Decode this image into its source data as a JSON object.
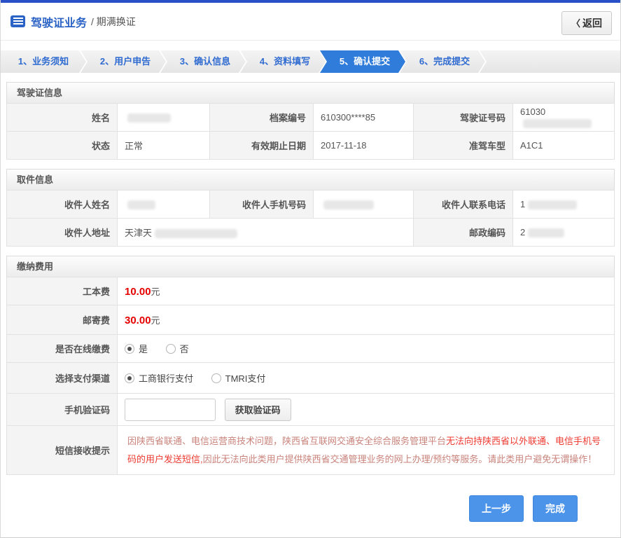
{
  "header": {
    "title": "驾驶证业务",
    "subtitle": "/ 期满换证",
    "back_icon": "〈",
    "back_label": "返回"
  },
  "steps": [
    {
      "label": "1、业务须知",
      "active": false
    },
    {
      "label": "2、用户申告",
      "active": false
    },
    {
      "label": "3、确认信息",
      "active": false
    },
    {
      "label": "4、资料填写",
      "active": false
    },
    {
      "label": "5、确认提交",
      "active": true
    },
    {
      "label": "6、完成提交",
      "active": false
    }
  ],
  "license": {
    "title": "驾驶证信息",
    "name_label": "姓名",
    "name_value": "",
    "file_no_label": "档案编号",
    "file_no_value": "610300****85",
    "license_no_label": "驾驶证号码",
    "license_no_value": "61030",
    "status_label": "状态",
    "status_value": "正常",
    "expiry_label": "有效期止日期",
    "expiry_value": "2017-11-18",
    "vehicle_class_label": "准驾车型",
    "vehicle_class_value": "A1C1"
  },
  "pickup": {
    "title": "取件信息",
    "recipient_name_label": "收件人姓名",
    "recipient_name_value": "",
    "recipient_mobile_label": "收件人手机号码",
    "recipient_mobile_value": "",
    "recipient_phone_label": "收件人联系电话",
    "recipient_phone_value": "1",
    "recipient_address_label": "收件人地址",
    "recipient_address_value": "天津天",
    "postal_code_label": "邮政编码",
    "postal_code_value": "2"
  },
  "fees": {
    "title": "缴纳费用",
    "cost_label": "工本费",
    "cost_value": "10.00",
    "cost_unit": "元",
    "postage_label": "邮寄费",
    "postage_value": "30.00",
    "postage_unit": "元",
    "online_pay_label": "是否在线缴费",
    "online_yes": "是",
    "online_no": "否",
    "online_selected": "是",
    "channel_label": "选择支付渠道",
    "channel_icbc": "工商银行支付",
    "channel_tmri": "TMRI支付",
    "channel_selected": "工商银行支付",
    "sms_code_label": "手机验证码",
    "sms_code_value": "",
    "get_code_button": "获取验证码",
    "notice_label": "短信接收提示",
    "notice_part1": "因陕西省联通、电信运营商技术问题，陕西省互联网交通安全综合服务管理平台",
    "notice_part2": "无法向持陕西省以外联通、电信手机号码的用户发送短信,",
    "notice_part3": "因此无法向此类用户提供陕西省交通管理业务的网上办理/预约等服务。请此类用户避免无谓操作！"
  },
  "footer": {
    "prev_button": "上一步",
    "done_button": "完成"
  },
  "colors": {
    "top_bar_blue": "#2a50c8",
    "title_blue": "#2b62c5",
    "step_active_blue": "#2f7cdb",
    "button_blue": "#4b94ea",
    "fee_red": "#e50000",
    "notice_red": "#ee3b32"
  }
}
